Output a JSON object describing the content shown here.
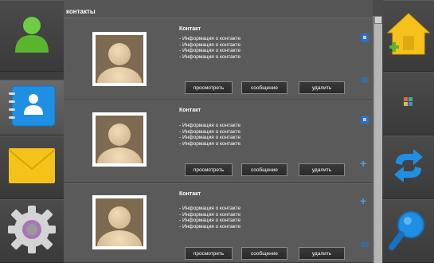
{
  "title": "контакты",
  "left_nav": [
    {
      "icon": "person-icon",
      "active": false
    },
    {
      "icon": "address-book-icon",
      "active": true
    },
    {
      "icon": "envelope-icon",
      "active": false
    },
    {
      "icon": "gear-icon",
      "active": false
    }
  ],
  "contacts": [
    {
      "name": "Контакт",
      "info": [
        "- Информация о контакте",
        "- Информация о контакте",
        "- Информация о контакте",
        "- Информация о контакте"
      ],
      "actions": {
        "view": "просмотреть",
        "message": "сообщение",
        "delete": "удалить"
      },
      "badges": [
        "vk-icon",
        "small-blue-icon"
      ]
    },
    {
      "name": "Контакт",
      "info": [
        "- Информация о контакте",
        "- Информация о контакте",
        "- Информация о контакте",
        "- Информация о контакте"
      ],
      "actions": {
        "view": "просмотреть",
        "message": "сообщение",
        "delete": "удалить"
      },
      "badges": [
        "vk-icon",
        "plus-icon"
      ]
    },
    {
      "name": "Контакт",
      "info": [
        "- Информация о контакте",
        "- Информация о контакте",
        "- Информация о контакте",
        "- Информация о контакте"
      ],
      "actions": {
        "view": "просмотреть",
        "message": "сообщение",
        "delete": "удалить"
      },
      "badges": [
        "plus-icon",
        "small-blue-icon"
      ]
    }
  ],
  "right_nav": [
    {
      "icon": "home-add-icon"
    },
    {
      "icon": "small-grid-icon"
    },
    {
      "icon": "sync-icon"
    },
    {
      "icon": "search-icon"
    }
  ],
  "colors": {
    "accent_blue": "#1f8fe3",
    "accent_green": "#5ab52d",
    "accent_yellow": "#f5c21a"
  }
}
